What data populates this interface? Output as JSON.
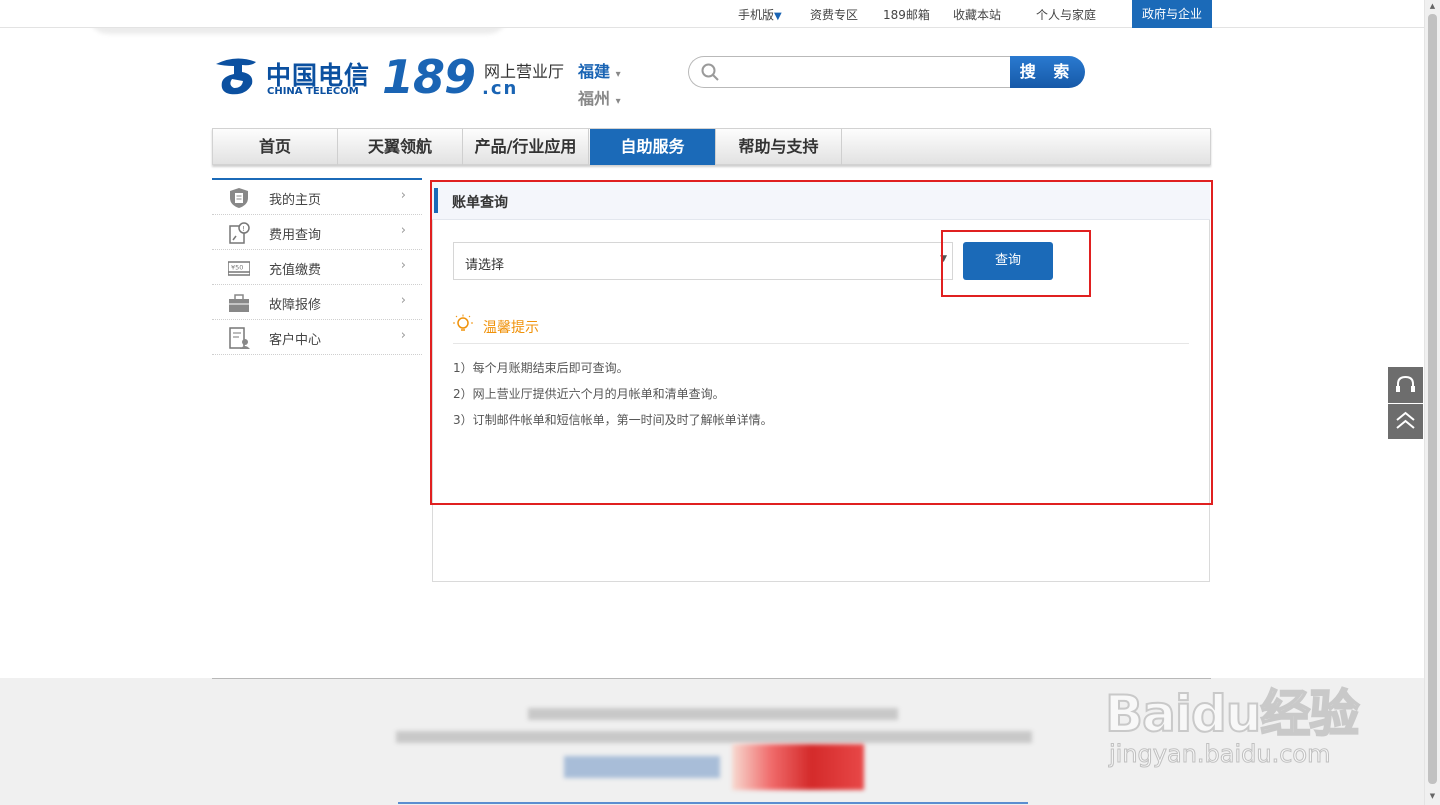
{
  "top_nav": {
    "mobile": "手机版",
    "tariff_zone": "资费专区",
    "mail_189": "189邮箱",
    "bookmark": "收藏本站",
    "personal_home": "个人与家庭",
    "government_enterprise": "政府与企业"
  },
  "header": {
    "logo_cn": "中国电信",
    "logo_en": "CHINA TELECOM",
    "logo_189": "189",
    "logo_domain": ".cn",
    "hall_name": "网上营业厅",
    "province": "福建",
    "city": "福州"
  },
  "search": {
    "placeholder": "",
    "button_label": "搜 索"
  },
  "main_nav": [
    {
      "label": "首页"
    },
    {
      "label": "天翼领航"
    },
    {
      "label": "产品/行业应用"
    },
    {
      "label": "自助服务",
      "active": true
    },
    {
      "label": "帮助与支持"
    }
  ],
  "side_menu": [
    {
      "label": "我的主页",
      "icon": "shield-user-icon"
    },
    {
      "label": "费用查询",
      "icon": "bill-search-icon"
    },
    {
      "label": "充值缴费",
      "icon": "recharge-card-icon"
    },
    {
      "label": "故障报修",
      "icon": "toolbox-icon"
    },
    {
      "label": "客户中心",
      "icon": "customer-profile-icon"
    }
  ],
  "bill_query": {
    "title": "账单查询",
    "select_value": "请选择",
    "query_button": "查询",
    "tips_title": "温馨提示",
    "tips": [
      "1）每个月账期结束后即可查询。",
      "2）网上营业厅提供近六个月的月帐单和清单查询。",
      "3）订制邮件帐单和短信帐单，第一时间及时了解帐单详情。"
    ]
  },
  "watermark": {
    "brand": "Baidu经验",
    "url": "jingyan.baidu.com"
  },
  "colors": {
    "brand_blue": "#1b6ab8",
    "highlight_red": "#e02020",
    "tips_orange": "#f0920a"
  }
}
